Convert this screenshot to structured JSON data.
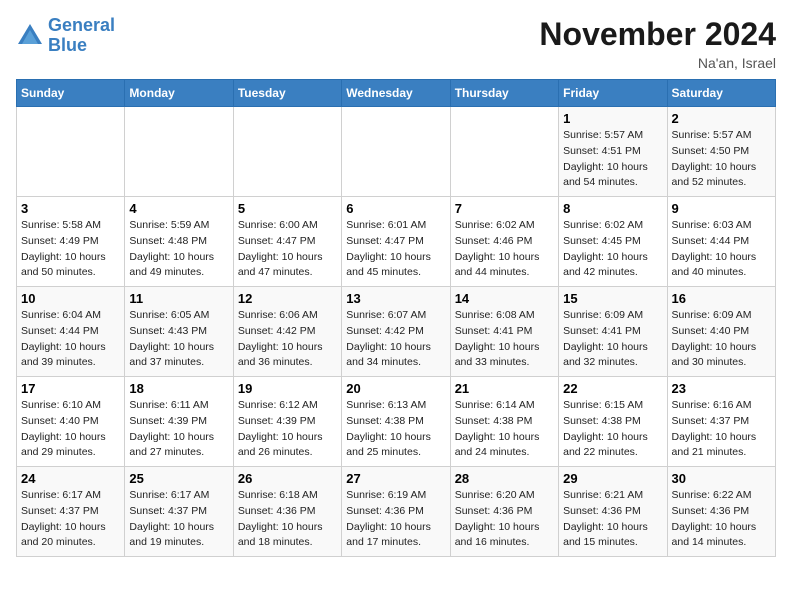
{
  "logo": {
    "line1": "General",
    "line2": "Blue"
  },
  "title": "November 2024",
  "location": "Na'an, Israel",
  "days_header": [
    "Sunday",
    "Monday",
    "Tuesday",
    "Wednesday",
    "Thursday",
    "Friday",
    "Saturday"
  ],
  "weeks": [
    [
      {
        "day": "",
        "info": ""
      },
      {
        "day": "",
        "info": ""
      },
      {
        "day": "",
        "info": ""
      },
      {
        "day": "",
        "info": ""
      },
      {
        "day": "",
        "info": ""
      },
      {
        "day": "1",
        "info": "Sunrise: 5:57 AM\nSunset: 4:51 PM\nDaylight: 10 hours\nand 54 minutes."
      },
      {
        "day": "2",
        "info": "Sunrise: 5:57 AM\nSunset: 4:50 PM\nDaylight: 10 hours\nand 52 minutes."
      }
    ],
    [
      {
        "day": "3",
        "info": "Sunrise: 5:58 AM\nSunset: 4:49 PM\nDaylight: 10 hours\nand 50 minutes."
      },
      {
        "day": "4",
        "info": "Sunrise: 5:59 AM\nSunset: 4:48 PM\nDaylight: 10 hours\nand 49 minutes."
      },
      {
        "day": "5",
        "info": "Sunrise: 6:00 AM\nSunset: 4:47 PM\nDaylight: 10 hours\nand 47 minutes."
      },
      {
        "day": "6",
        "info": "Sunrise: 6:01 AM\nSunset: 4:47 PM\nDaylight: 10 hours\nand 45 minutes."
      },
      {
        "day": "7",
        "info": "Sunrise: 6:02 AM\nSunset: 4:46 PM\nDaylight: 10 hours\nand 44 minutes."
      },
      {
        "day": "8",
        "info": "Sunrise: 6:02 AM\nSunset: 4:45 PM\nDaylight: 10 hours\nand 42 minutes."
      },
      {
        "day": "9",
        "info": "Sunrise: 6:03 AM\nSunset: 4:44 PM\nDaylight: 10 hours\nand 40 minutes."
      }
    ],
    [
      {
        "day": "10",
        "info": "Sunrise: 6:04 AM\nSunset: 4:44 PM\nDaylight: 10 hours\nand 39 minutes."
      },
      {
        "day": "11",
        "info": "Sunrise: 6:05 AM\nSunset: 4:43 PM\nDaylight: 10 hours\nand 37 minutes."
      },
      {
        "day": "12",
        "info": "Sunrise: 6:06 AM\nSunset: 4:42 PM\nDaylight: 10 hours\nand 36 minutes."
      },
      {
        "day": "13",
        "info": "Sunrise: 6:07 AM\nSunset: 4:42 PM\nDaylight: 10 hours\nand 34 minutes."
      },
      {
        "day": "14",
        "info": "Sunrise: 6:08 AM\nSunset: 4:41 PM\nDaylight: 10 hours\nand 33 minutes."
      },
      {
        "day": "15",
        "info": "Sunrise: 6:09 AM\nSunset: 4:41 PM\nDaylight: 10 hours\nand 32 minutes."
      },
      {
        "day": "16",
        "info": "Sunrise: 6:09 AM\nSunset: 4:40 PM\nDaylight: 10 hours\nand 30 minutes."
      }
    ],
    [
      {
        "day": "17",
        "info": "Sunrise: 6:10 AM\nSunset: 4:40 PM\nDaylight: 10 hours\nand 29 minutes."
      },
      {
        "day": "18",
        "info": "Sunrise: 6:11 AM\nSunset: 4:39 PM\nDaylight: 10 hours\nand 27 minutes."
      },
      {
        "day": "19",
        "info": "Sunrise: 6:12 AM\nSunset: 4:39 PM\nDaylight: 10 hours\nand 26 minutes."
      },
      {
        "day": "20",
        "info": "Sunrise: 6:13 AM\nSunset: 4:38 PM\nDaylight: 10 hours\nand 25 minutes."
      },
      {
        "day": "21",
        "info": "Sunrise: 6:14 AM\nSunset: 4:38 PM\nDaylight: 10 hours\nand 24 minutes."
      },
      {
        "day": "22",
        "info": "Sunrise: 6:15 AM\nSunset: 4:38 PM\nDaylight: 10 hours\nand 22 minutes."
      },
      {
        "day": "23",
        "info": "Sunrise: 6:16 AM\nSunset: 4:37 PM\nDaylight: 10 hours\nand 21 minutes."
      }
    ],
    [
      {
        "day": "24",
        "info": "Sunrise: 6:17 AM\nSunset: 4:37 PM\nDaylight: 10 hours\nand 20 minutes."
      },
      {
        "day": "25",
        "info": "Sunrise: 6:17 AM\nSunset: 4:37 PM\nDaylight: 10 hours\nand 19 minutes."
      },
      {
        "day": "26",
        "info": "Sunrise: 6:18 AM\nSunset: 4:36 PM\nDaylight: 10 hours\nand 18 minutes."
      },
      {
        "day": "27",
        "info": "Sunrise: 6:19 AM\nSunset: 4:36 PM\nDaylight: 10 hours\nand 17 minutes."
      },
      {
        "day": "28",
        "info": "Sunrise: 6:20 AM\nSunset: 4:36 PM\nDaylight: 10 hours\nand 16 minutes."
      },
      {
        "day": "29",
        "info": "Sunrise: 6:21 AM\nSunset: 4:36 PM\nDaylight: 10 hours\nand 15 minutes."
      },
      {
        "day": "30",
        "info": "Sunrise: 6:22 AM\nSunset: 4:36 PM\nDaylight: 10 hours\nand 14 minutes."
      }
    ]
  ]
}
